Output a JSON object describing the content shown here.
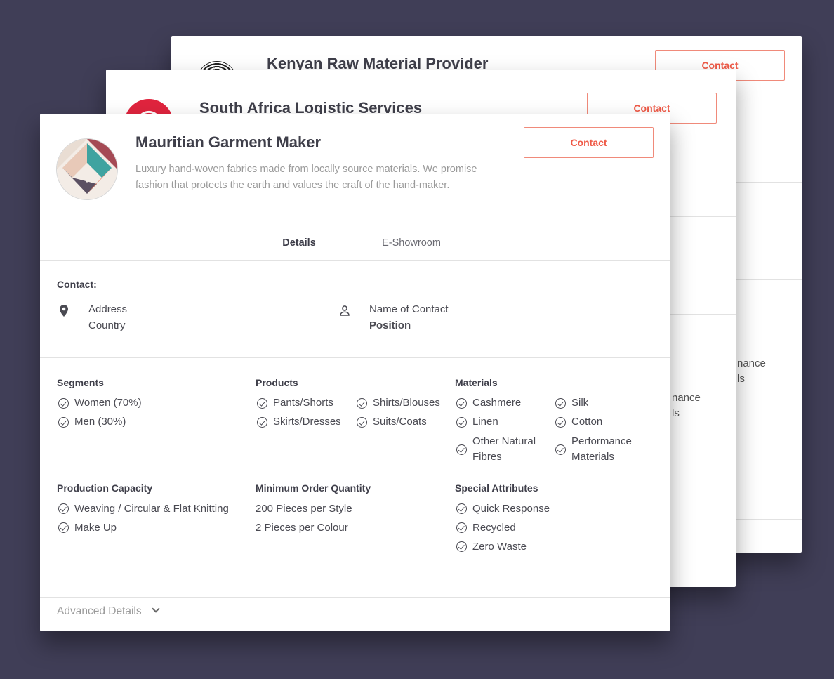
{
  "cards": {
    "back1": {
      "title": "Kenyan Raw Material Provider",
      "contact": "Contact"
    },
    "back2": {
      "title": "South Africa Logistic Services",
      "contact": "Contact"
    }
  },
  "ghost_text": {
    "back1_line1": "nance",
    "back1_line2": "ls",
    "back2_line1": "nance",
    "back2_line2": "ls"
  },
  "front": {
    "title": "Mauritian Garment Maker",
    "description": "Luxury hand-woven fabrics made from locally source materials. We promise fashion that protects the earth and values the craft of the hand-maker.",
    "contact": "Contact",
    "tabs": [
      "Details",
      "E-Showroom"
    ],
    "contact_label": "Contact:",
    "address": "Address",
    "country": "Country",
    "name_of_contact": "Name of Contact",
    "position": "Position",
    "segments": {
      "label": "Segments",
      "items": [
        "Women (70%)",
        "Men (30%)"
      ]
    },
    "products": {
      "label": "Products",
      "items": [
        "Pants/Shorts",
        "Shirts/Blouses",
        "Skirts/Dresses",
        "Suits/Coats"
      ]
    },
    "materials": {
      "label": "Materials",
      "items": [
        "Cashmere",
        "Silk",
        "Linen",
        "Cotton",
        "Other Natural Fibres",
        "Performance Materials"
      ]
    },
    "production": {
      "label": "Production Capacity",
      "items": [
        "Weaving / Circular & Flat Knitting",
        "Make Up"
      ]
    },
    "moq": {
      "label": "Minimum Order Quantity",
      "items": [
        "200 Pieces per Style",
        "2 Pieces per Colour"
      ]
    },
    "special": {
      "label": "Special Attributes",
      "items": [
        "Quick Response",
        "Recycled",
        "Zero Waste"
      ]
    },
    "advanced": "Advanced Details"
  },
  "icons": {
    "location": "location-pin-icon",
    "person": "person-icon",
    "check": "check-circle-icon",
    "chevron": "chevron-down-icon"
  },
  "colors": {
    "accent": "#ef5a47",
    "background": "#403e57"
  }
}
